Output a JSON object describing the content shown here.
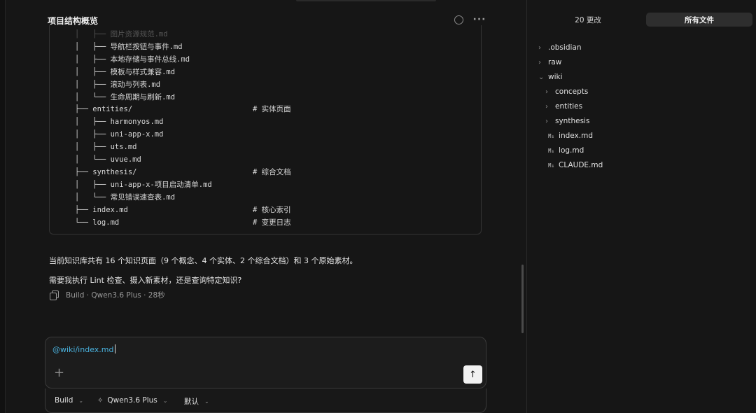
{
  "header": {
    "title": "项目结构概览",
    "status_icon": "circle-icon",
    "more_icon": "more-icon"
  },
  "code_block": {
    "lines": [
      {
        "text": "│   ├── 图片资源规范.md",
        "faded": true
      },
      {
        "text": "│   ├── 导航栏按钮与事件.md"
      },
      {
        "text": "│   ├── 本地存储与事件总线.md"
      },
      {
        "text": "│   ├── 模板与样式兼容.md"
      },
      {
        "text": "│   ├── 滚动与列表.md"
      },
      {
        "text": "│   └── 生命周期与刷新.md"
      },
      {
        "text": "├── entities/",
        "comment": "# 实体页面"
      },
      {
        "text": "│   ├── harmonyos.md"
      },
      {
        "text": "│   ├── uni-app-x.md"
      },
      {
        "text": "│   ├── uts.md"
      },
      {
        "text": "│   └── uvue.md"
      },
      {
        "text": "├── synthesis/",
        "comment": "# 综合文档"
      },
      {
        "text": "│   ├── uni-app-x-项目启动清单.md"
      },
      {
        "text": "│   └── 常见错误速查表.md"
      },
      {
        "text": "├── index.md",
        "comment": "# 核心索引"
      },
      {
        "text": "└── log.md",
        "comment": "# 变更日志"
      }
    ]
  },
  "message": {
    "summary": "当前知识库共有 16 个知识页面（9 个概念、4 个实体、2 个综合文档）和 3 个原始素材。",
    "question": "需要我执行 Lint 检查、摄入新素材，还是查询特定知识?",
    "meta": "Build · Qwen3.6 Plus · 28秒"
  },
  "composer": {
    "text": "@wiki/index.md",
    "mode": "Build",
    "model": "Qwen3.6 Plus",
    "variant": "默认"
  },
  "panel": {
    "tab_changes": "20 更改",
    "tab_all": "所有文件",
    "md_badge": "M↓",
    "tree": [
      {
        "label": ".obsidian",
        "type": "folder",
        "depth": 0,
        "open": false
      },
      {
        "label": "raw",
        "type": "folder",
        "depth": 0,
        "open": false
      },
      {
        "label": "wiki",
        "type": "folder",
        "depth": 0,
        "open": true
      },
      {
        "label": "concepts",
        "type": "folder",
        "depth": 1,
        "open": false
      },
      {
        "label": "entities",
        "type": "folder",
        "depth": 1,
        "open": false
      },
      {
        "label": "synthesis",
        "type": "folder",
        "depth": 1,
        "open": false
      },
      {
        "label": "index.md",
        "type": "file",
        "depth": 1
      },
      {
        "label": "log.md",
        "type": "file",
        "depth": 1
      },
      {
        "label": "CLAUDE.md",
        "type": "file",
        "depth": 1
      }
    ]
  },
  "colors": {
    "background": "#161616",
    "mention": "#4ab3e0",
    "active_tab": "#2e2e2e"
  }
}
